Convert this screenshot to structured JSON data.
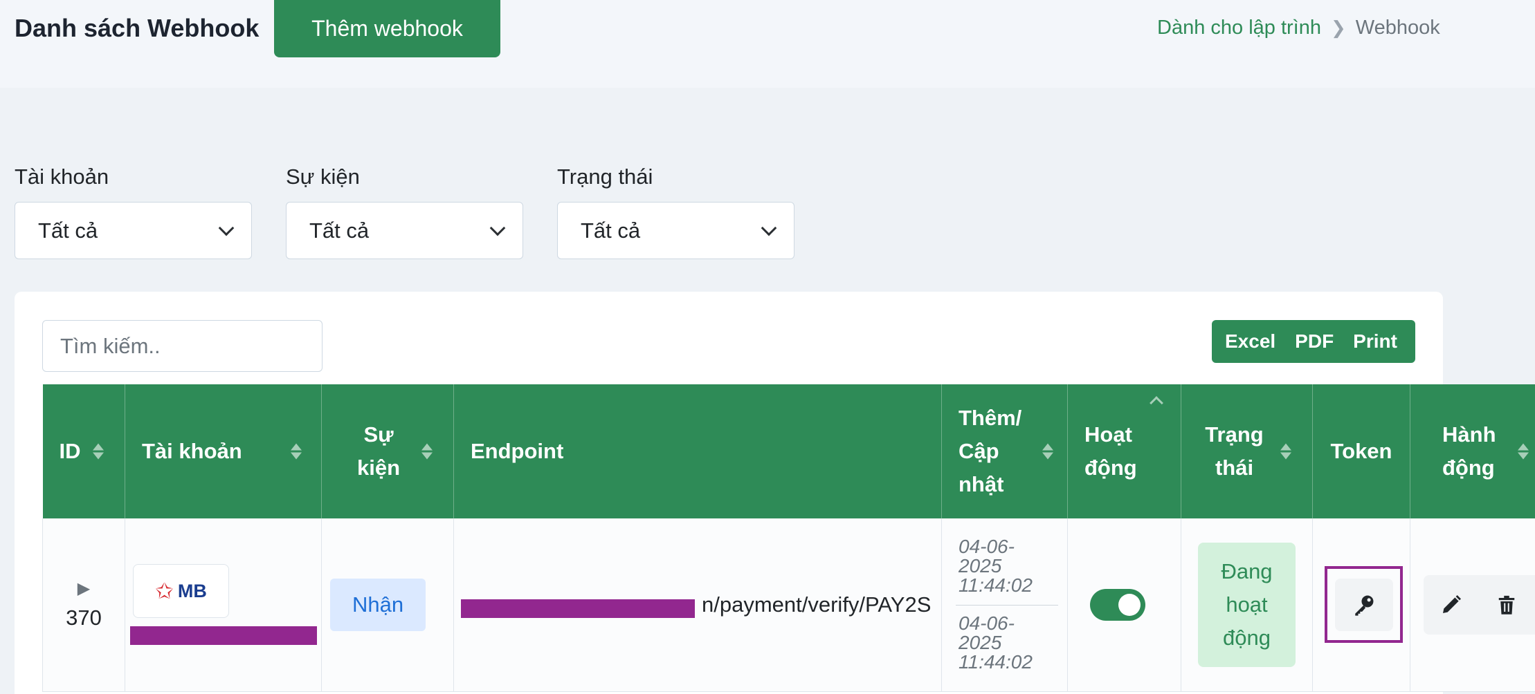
{
  "header": {
    "title": "Danh sách Webhook",
    "add_button": "Thêm webhook",
    "breadcrumb": {
      "parent": "Dành cho lập trình",
      "current": "Webhook"
    }
  },
  "filters": [
    {
      "label": "Tài khoản",
      "value": "Tất cả"
    },
    {
      "label": "Sự kiện",
      "value": "Tất cả"
    },
    {
      "label": "Trạng thái",
      "value": "Tất cả"
    }
  ],
  "search": {
    "placeholder": "Tìm kiếm.."
  },
  "export": {
    "excel": "Excel",
    "pdf": "PDF",
    "print": "Print"
  },
  "table": {
    "columns": {
      "id": "ID",
      "account": "Tài khoản",
      "event_1": "Sự",
      "event_2": "kiện",
      "endpoint": "Endpoint",
      "added_1": "Thêm/",
      "added_2": "Cập",
      "added_3": "nhật",
      "active_1": "Hoạt",
      "active_2": "động",
      "status_1": "Trạng",
      "status_2": "thái",
      "token": "Token",
      "action_1": "Hành",
      "action_2": "động"
    },
    "rows": [
      {
        "id": "370",
        "bank_logo_text": "MB",
        "event": "Nhận",
        "endpoint_visible": "n/payment/verify/PAY2S",
        "created_1": "04-06-",
        "created_2": "2025",
        "created_3": "11:44:02",
        "updated_1": "04-06-",
        "updated_2": "2025",
        "updated_3": "11:44:02",
        "active": true,
        "status_1": "Đang",
        "status_2": "hoạt",
        "status_3": "động"
      }
    ]
  },
  "colors": {
    "primary": "#2e8b57",
    "redaction": "#92278f",
    "badge_blue": "#dbe9ff",
    "badge_green": "#d3f1dc"
  }
}
